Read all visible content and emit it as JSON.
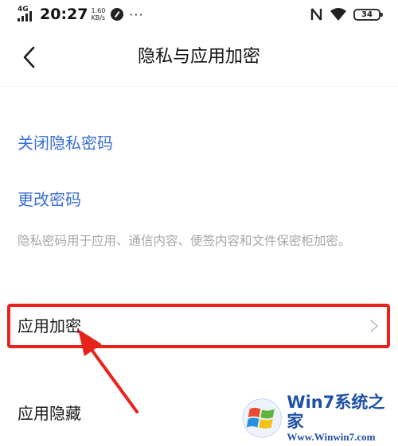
{
  "status_bar": {
    "network": "4G",
    "time": "20:27",
    "speed_value": "1.60",
    "speed_unit": "KB/s",
    "more": "···",
    "battery": "34"
  },
  "header": {
    "title": "隐私与应用加密"
  },
  "settings": {
    "close_privacy_password": "关闭隐私密码",
    "change_password": "更改密码",
    "hint": "隐私密码用于应用、通信内容、便签内容和文件保密柜加密。",
    "app_encryption": "应用加密",
    "app_hide": "应用隐藏"
  },
  "colors": {
    "link": "#3a6fd8",
    "highlight": "#e8231b",
    "hint": "#a6a6a6"
  },
  "watermark": {
    "brand": "Win7系统之家",
    "url": "Www.Winwin7.com"
  }
}
